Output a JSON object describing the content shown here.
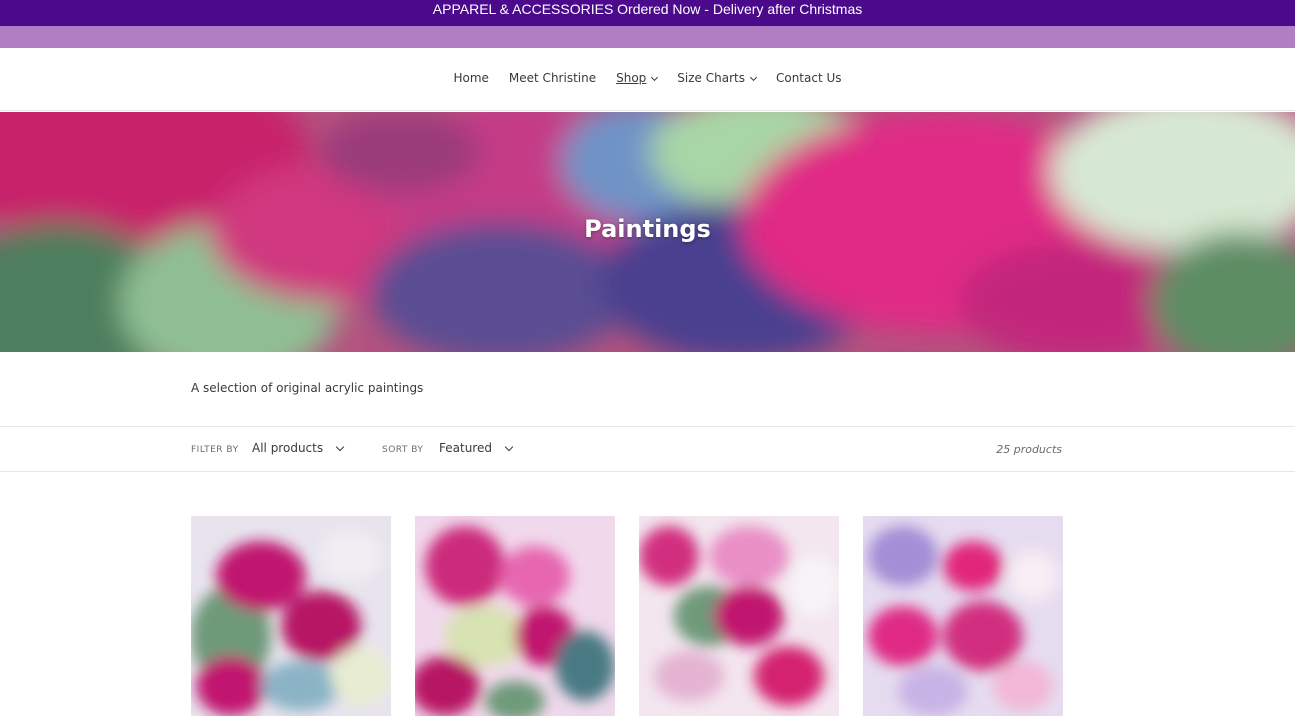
{
  "announcement": {
    "text": "APPAREL & ACCESSORIES Ordered Now - Delivery after Christmas"
  },
  "nav": {
    "items": [
      {
        "label": "Home",
        "has_dropdown": false,
        "active": false
      },
      {
        "label": "Meet Christine",
        "has_dropdown": false,
        "active": false
      },
      {
        "label": "Shop",
        "has_dropdown": true,
        "active": true
      },
      {
        "label": "Size Charts",
        "has_dropdown": true,
        "active": false
      },
      {
        "label": "Contact Us",
        "has_dropdown": false,
        "active": false
      }
    ]
  },
  "hero": {
    "title": "Paintings"
  },
  "collection": {
    "description": "A selection of original acrylic paintings"
  },
  "filters": {
    "filter_label": "FILTER BY",
    "filter_value": "All products",
    "sort_label": "SORT BY",
    "sort_value": "Featured",
    "product_count": "25 products"
  },
  "colors": {
    "announcement_bg": "#4b0a8c",
    "lilac_band": "#b07fc3",
    "accent_magenta": "#d6287a"
  }
}
